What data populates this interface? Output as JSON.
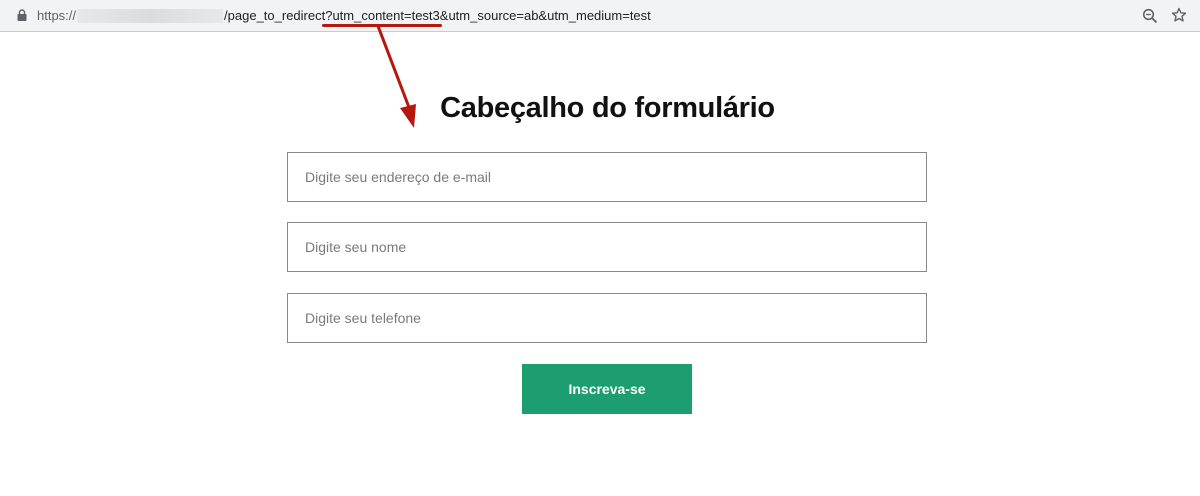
{
  "browser": {
    "url_scheme": "https://",
    "url_path": "/page_to_redirect",
    "url_query_highlighted": "?utm_content=test3",
    "url_query_rest": "&utm_source=ab&utm_medium=test"
  },
  "annotation": {
    "color": "#b5180e"
  },
  "form": {
    "title": "Cabeçalho do formulário",
    "email_placeholder": "Digite seu endereço de e-mail",
    "name_placeholder": "Digite seu nome",
    "phone_placeholder": "Digite seu telefone",
    "submit_label": "Inscreva-se",
    "button_color": "#1c9e6e"
  }
}
